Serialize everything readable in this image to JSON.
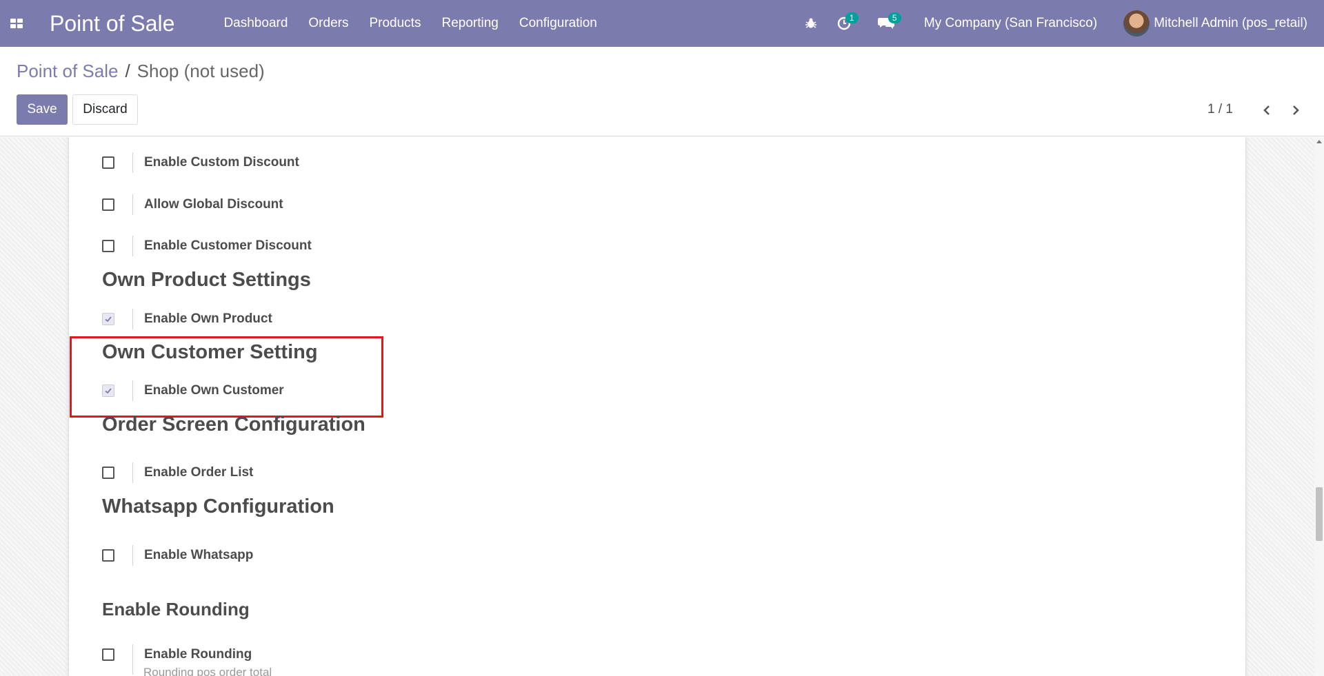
{
  "navbar": {
    "brand": "Point of Sale",
    "menu": [
      "Dashboard",
      "Orders",
      "Products",
      "Reporting",
      "Configuration"
    ],
    "activity_count": "1",
    "message_count": "5",
    "company": "My Company (San Francisco)",
    "user": "Mitchell Admin (pos_retail)",
    "color": "#7c7bad"
  },
  "breadcrumb": {
    "parent": "Point of Sale",
    "separator": "/",
    "current": "Shop (not used)"
  },
  "buttons": {
    "save": "Save",
    "discard": "Discard"
  },
  "pager": {
    "value": "1 / 1"
  },
  "settings": {
    "custom_discount": {
      "label": "Enable Custom Discount",
      "checked": false
    },
    "global_discount": {
      "label": "Allow Global Discount",
      "checked": false
    },
    "customer_discount": {
      "label": "Enable Customer Discount",
      "checked": false
    },
    "own_product_title": "Own Product Settings",
    "own_product": {
      "label": "Enable Own Product",
      "checked": true
    },
    "own_customer_title": "Own Customer Setting",
    "own_customer": {
      "label": "Enable Own Customer",
      "checked": true
    },
    "order_screen_title": "Order Screen Configuration",
    "order_list": {
      "label": "Enable Order List",
      "checked": false
    },
    "whatsapp_title": "Whatsapp Configuration",
    "whatsapp": {
      "label": "Enable Whatsapp",
      "checked": false
    },
    "rounding_title": "Enable Rounding",
    "rounding": {
      "label": "Enable Rounding",
      "checked": false,
      "help": "Rounding pos order total"
    }
  },
  "annotation_color": "#e21818"
}
